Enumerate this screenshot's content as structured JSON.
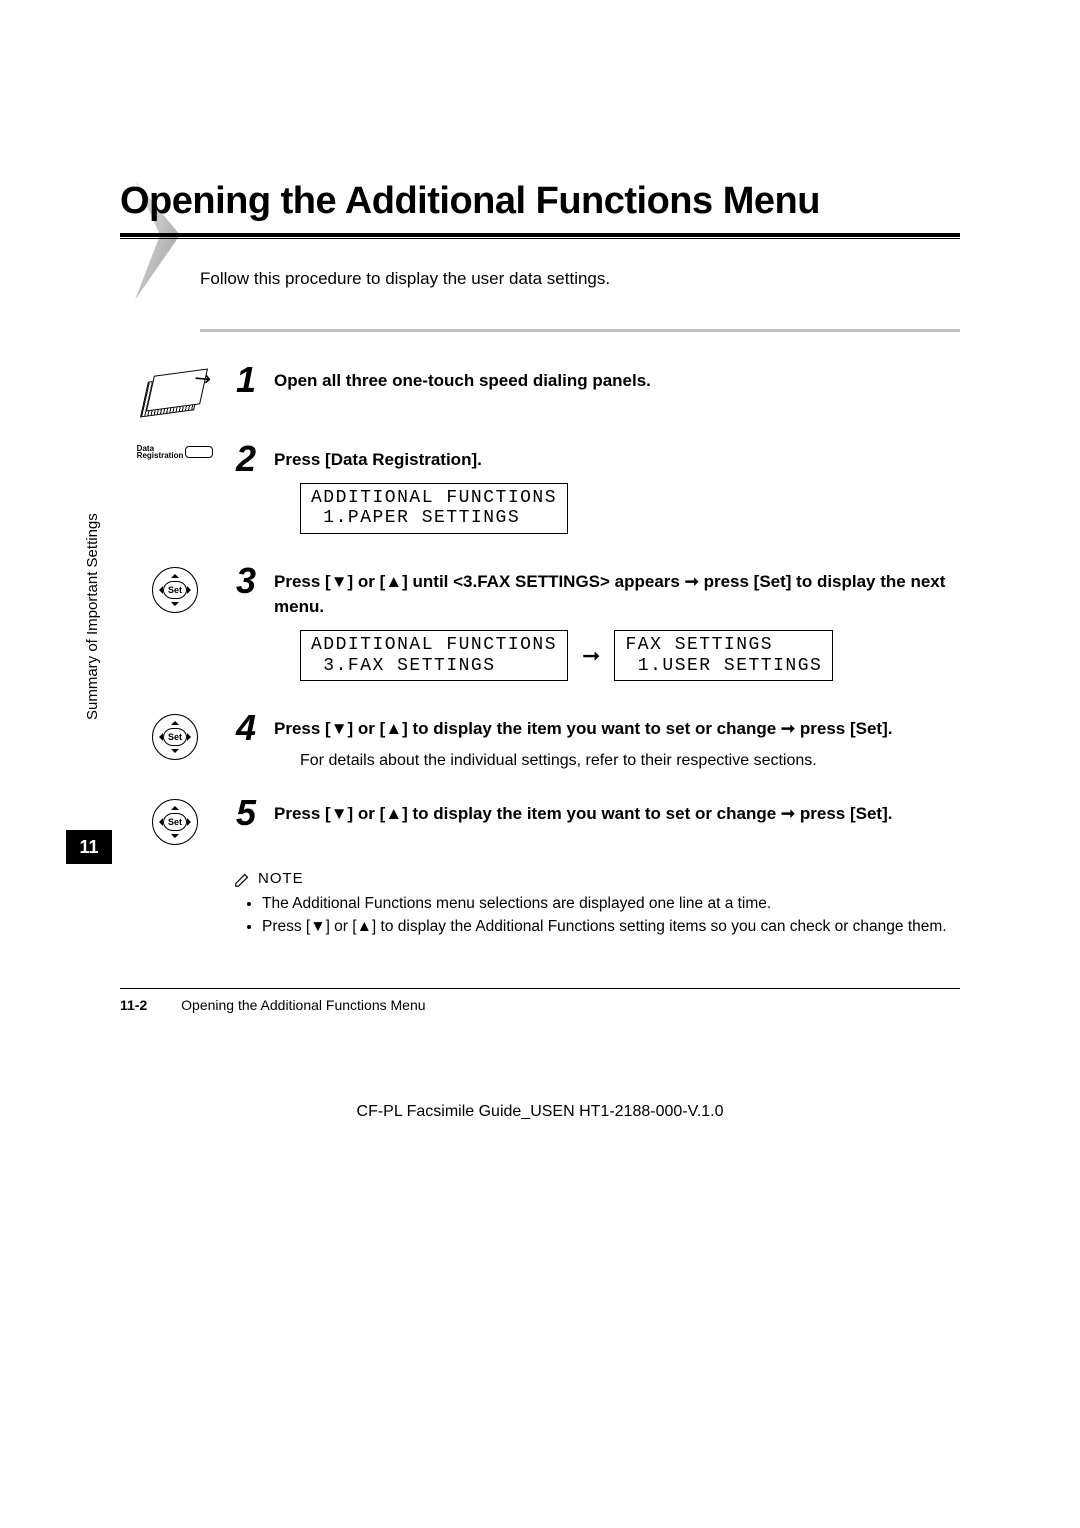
{
  "title": "Opening the Additional Functions Menu",
  "intro": "Follow this procedure to display the user data settings.",
  "sidebar": {
    "label": "Summary of Important Settings",
    "chapter": "11"
  },
  "steps": [
    {
      "num": "1",
      "icon": "panels",
      "head_plain": "Open all three one-touch speed dialing panels."
    },
    {
      "num": "2",
      "icon": "datareg",
      "head_plain": "Press [Data Registration].",
      "lcd1_line1": "ADDITIONAL FUNCTIONS",
      "lcd1_line2": " 1.PAPER SETTINGS"
    },
    {
      "num": "3",
      "icon": "setpad",
      "head_pre": "Press [",
      "tri1": "▼",
      "head_mid1": "] or [",
      "tri2": "▲",
      "head_mid2": "] until <3.FAX SETTINGS> appears ",
      "arrow": "➞",
      "head_post": " press [Set] to display the next menu.",
      "lcdA_line1": "ADDITIONAL FUNCTIONS",
      "lcdA_line2": " 3.FAX SETTINGS",
      "lcd_arrow": "➞",
      "lcdB_line1": "FAX SETTINGS",
      "lcdB_line2": " 1.USER SETTINGS"
    },
    {
      "num": "4",
      "icon": "setpad",
      "head_pre": "Press [",
      "tri1": "▼",
      "head_mid1": "] or [",
      "tri2": "▲",
      "head_mid2": "] to display the item you want to set or change ",
      "arrow": "➞",
      "head_post": " press [Set].",
      "sub": "For details about the individual settings, refer to their respective sections."
    },
    {
      "num": "5",
      "icon": "setpad",
      "head_pre": "Press [",
      "tri1": "▼",
      "head_mid1": "] or [",
      "tri2": "▲",
      "head_mid2": "] to display the item you want to set or change ",
      "arrow": "➞",
      "head_post": " press [Set]."
    }
  ],
  "note": {
    "label": "NOTE",
    "items": [
      "The Additional Functions menu selections are displayed one line at a time.",
      "Press [▼] or [▲] to display the Additional Functions setting items so you can check or change them."
    ]
  },
  "footer": {
    "pageno": "11-2",
    "caption": "Opening the Additional Functions Menu",
    "docid": "CF-PL Facsimile Guide_USEN HT1-2188-000-V.1.0"
  }
}
